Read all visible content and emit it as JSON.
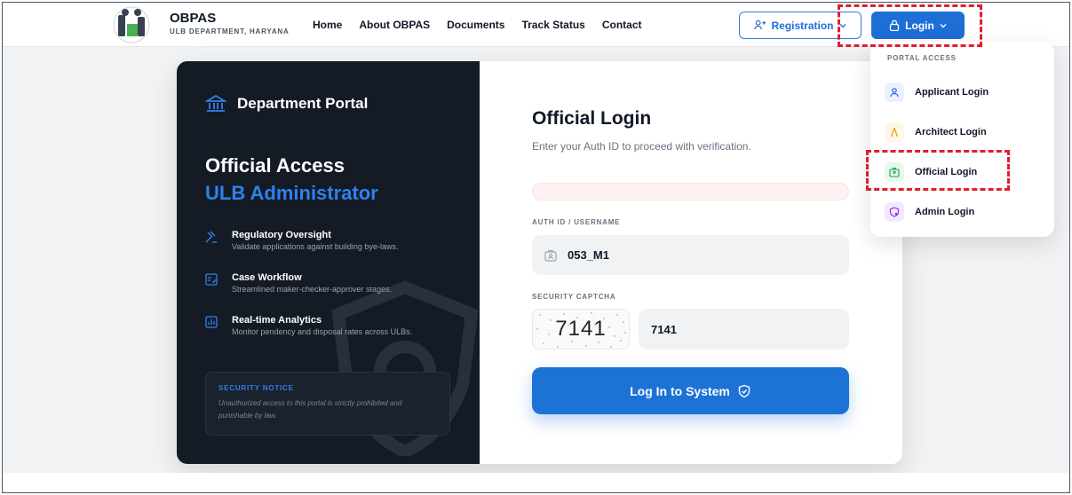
{
  "header": {
    "brand_name": "OBPAS",
    "brand_sub": "ULB DEPARTMENT, HARYANA",
    "nav": [
      "Home",
      "About OBPAS",
      "Documents",
      "Track Status",
      "Contact"
    ],
    "registration_label": "Registration",
    "login_label": "Login"
  },
  "left_panel": {
    "dept_title": "Department Portal",
    "heading": "Official Access",
    "subheading": "ULB Administrator",
    "features": [
      {
        "title": "Regulatory Oversight",
        "desc": "Validate applications against building bye-laws."
      },
      {
        "title": "Case Workflow",
        "desc": "Streamlined maker-checker-approver stages."
      },
      {
        "title": "Real-time Analytics",
        "desc": "Monitor pendency and disposal rates across ULBs."
      }
    ],
    "notice_title": "SECURITY NOTICE",
    "notice_text": "Unauthorized access to this portal is strictly prohibited and punishable by law."
  },
  "form": {
    "title": "Official Login",
    "subtitle": "Enter your Auth ID to proceed with verification.",
    "auth_label": "AUTH ID / USERNAME",
    "auth_value": "053_M1",
    "captcha_label": "SECURITY CAPTCHA",
    "captcha_image_text": "7141",
    "captcha_value": "7141",
    "submit_label": "Log In to System"
  },
  "dropdown": {
    "header": "PORTAL ACCESS",
    "items": [
      {
        "label": "Applicant Login",
        "icon": "user-icon",
        "color": "#2563eb",
        "bg": "#eaf1fd"
      },
      {
        "label": "Architect Login",
        "icon": "compass-icon",
        "color": "#f59e0b",
        "bg": "#fef6e7"
      },
      {
        "label": "Official Login",
        "icon": "id-badge-icon",
        "color": "#16a34a",
        "bg": "#e8f7ee"
      },
      {
        "label": "Admin Login",
        "icon": "shield-icon",
        "color": "#9333ea",
        "bg": "#f3e8fd"
      }
    ]
  },
  "colors": {
    "primary": "#1d6fd6",
    "dark_panel": "#141b25",
    "accent_blue": "#2f80ed",
    "highlight_red": "#e11d2a"
  }
}
